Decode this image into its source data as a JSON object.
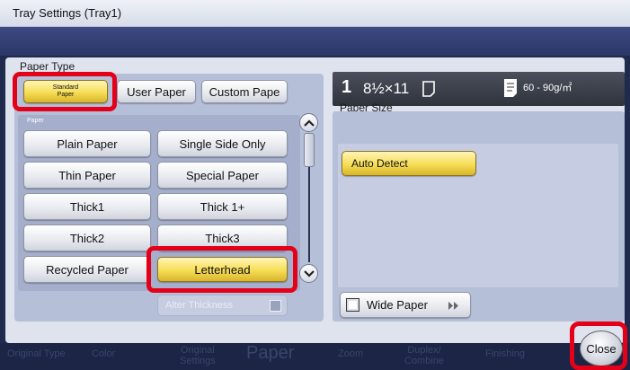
{
  "window": {
    "title": "Tray Settings (Tray1)"
  },
  "paper_type": {
    "label": "Paper Type",
    "tabs": [
      {
        "line1": "Standard",
        "line2": "Paper"
      },
      {
        "label": "User Paper"
      },
      {
        "label": "Custom Pape"
      }
    ],
    "category_label": "Paper",
    "types": [
      "Plain Paper",
      "Single Side Only",
      "Thin Paper",
      "Special Paper",
      "Thick1",
      "Thick 1+",
      "Thick2",
      "Thick3",
      "Recycled Paper",
      "Letterhead"
    ],
    "selected": "Letterhead",
    "alter_thickness": "Alter Thickness"
  },
  "tray_status": {
    "tray_number": "1",
    "size": "8½×11",
    "weight": "60 - 90g/㎡"
  },
  "paper_size": {
    "label": "Paper Size",
    "auto_detect": "Auto Detect",
    "wide_paper": "Wide Paper"
  },
  "bottom_tabs": {
    "original_type": "Original Type",
    "color": "Color",
    "original_settings_1": "Original",
    "original_settings_2": "Settings",
    "paper": "Paper",
    "zoom": "Zoom",
    "duplex_1": "Duplex/",
    "duplex_2": "Combine",
    "finishing": "Finishing"
  },
  "close": "Close",
  "colors": {
    "highlight": "#e5001a",
    "selected": "#f6dd55",
    "header": "#2b3666"
  }
}
